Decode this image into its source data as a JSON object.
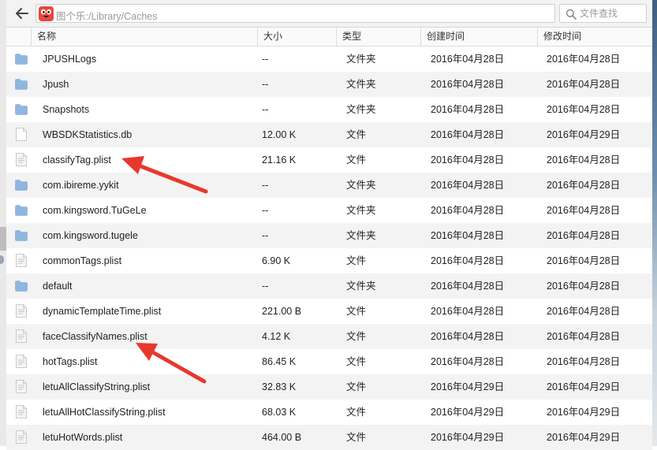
{
  "toolbar": {
    "path": "图个乐:/Library/Caches",
    "search_placeholder": "文件查找"
  },
  "columns": {
    "name": "名称",
    "size": "大小",
    "type": "类型",
    "created": "创建时间",
    "modified": "修改时间"
  },
  "rows": [
    {
      "icon": "folder-icon",
      "name": "JPUSHLogs",
      "size": "--",
      "type": "文件夹",
      "created": "2016年04月28日",
      "modified": "2016年04月28日"
    },
    {
      "icon": "folder-icon",
      "name": "Jpush",
      "size": "--",
      "type": "文件夹",
      "created": "2016年04月28日",
      "modified": "2016年04月28日"
    },
    {
      "icon": "folder-icon",
      "name": "Snapshots",
      "size": "--",
      "type": "文件夹",
      "created": "2016年04月28日",
      "modified": "2016年04月28日"
    },
    {
      "icon": "file-icon",
      "name": "WBSDKStatistics.db",
      "size": "12.00 K",
      "type": "文件",
      "created": "2016年04月28日",
      "modified": "2016年04月29日"
    },
    {
      "icon": "file-icon",
      "name": "classifyTag.plist",
      "size": "21.16 K",
      "type": "文件",
      "created": "2016年04月28日",
      "modified": "2016年04月28日"
    },
    {
      "icon": "folder-icon",
      "name": "com.ibireme.yykit",
      "size": "--",
      "type": "文件夹",
      "created": "2016年04月28日",
      "modified": "2016年04月28日"
    },
    {
      "icon": "folder-icon",
      "name": "com.kingsword.TuGeLe",
      "size": "--",
      "type": "文件夹",
      "created": "2016年04月28日",
      "modified": "2016年04月28日"
    },
    {
      "icon": "folder-icon",
      "name": "com.kingsword.tugele",
      "size": "--",
      "type": "文件夹",
      "created": "2016年04月28日",
      "modified": "2016年04月28日"
    },
    {
      "icon": "file-icon",
      "name": "commonTags.plist",
      "size": "6.90 K",
      "type": "文件",
      "created": "2016年04月28日",
      "modified": "2016年04月28日"
    },
    {
      "icon": "folder-icon",
      "name": "default",
      "size": "--",
      "type": "文件夹",
      "created": "2016年04月28日",
      "modified": "2016年04月28日"
    },
    {
      "icon": "file-icon",
      "name": "dynamicTemplateTime.plist",
      "size": "221.00 B",
      "type": "文件",
      "created": "2016年04月28日",
      "modified": "2016年04月28日"
    },
    {
      "icon": "file-icon",
      "name": "faceClassifyNames.plist",
      "size": "4.12 K",
      "type": "文件",
      "created": "2016年04月28日",
      "modified": "2016年04月28日"
    },
    {
      "icon": "file-icon",
      "name": "hotTags.plist",
      "size": "86.45 K",
      "type": "文件",
      "created": "2016年04月28日",
      "modified": "2016年04月28日"
    },
    {
      "icon": "file-icon",
      "name": "letuAllClassifyString.plist",
      "size": "32.83 K",
      "type": "文件",
      "created": "2016年04月29日",
      "modified": "2016年04月29日"
    },
    {
      "icon": "file-icon",
      "name": "letuAllHotClassifyString.plist",
      "size": "68.03 K",
      "type": "文件",
      "created": "2016年04月29日",
      "modified": "2016年04月29日"
    },
    {
      "icon": "file-icon",
      "name": "letuHotWords.plist",
      "size": "464.00 B",
      "type": "文件",
      "created": "2016年04月29日",
      "modified": "2016年04月29日"
    }
  ],
  "annotations": [
    {
      "name": "red-arrow-classifytag",
      "points_to": "classifyTag.plist",
      "color": "#e8382c"
    },
    {
      "name": "red-arrow-faceclassifynames",
      "points_to": "faceClassifyNames.plist",
      "color": "#e8382c"
    }
  ],
  "colors": {
    "folder": "#8fb6df",
    "annotation": "#e8382c",
    "row_alt": "#f3f3f3"
  }
}
